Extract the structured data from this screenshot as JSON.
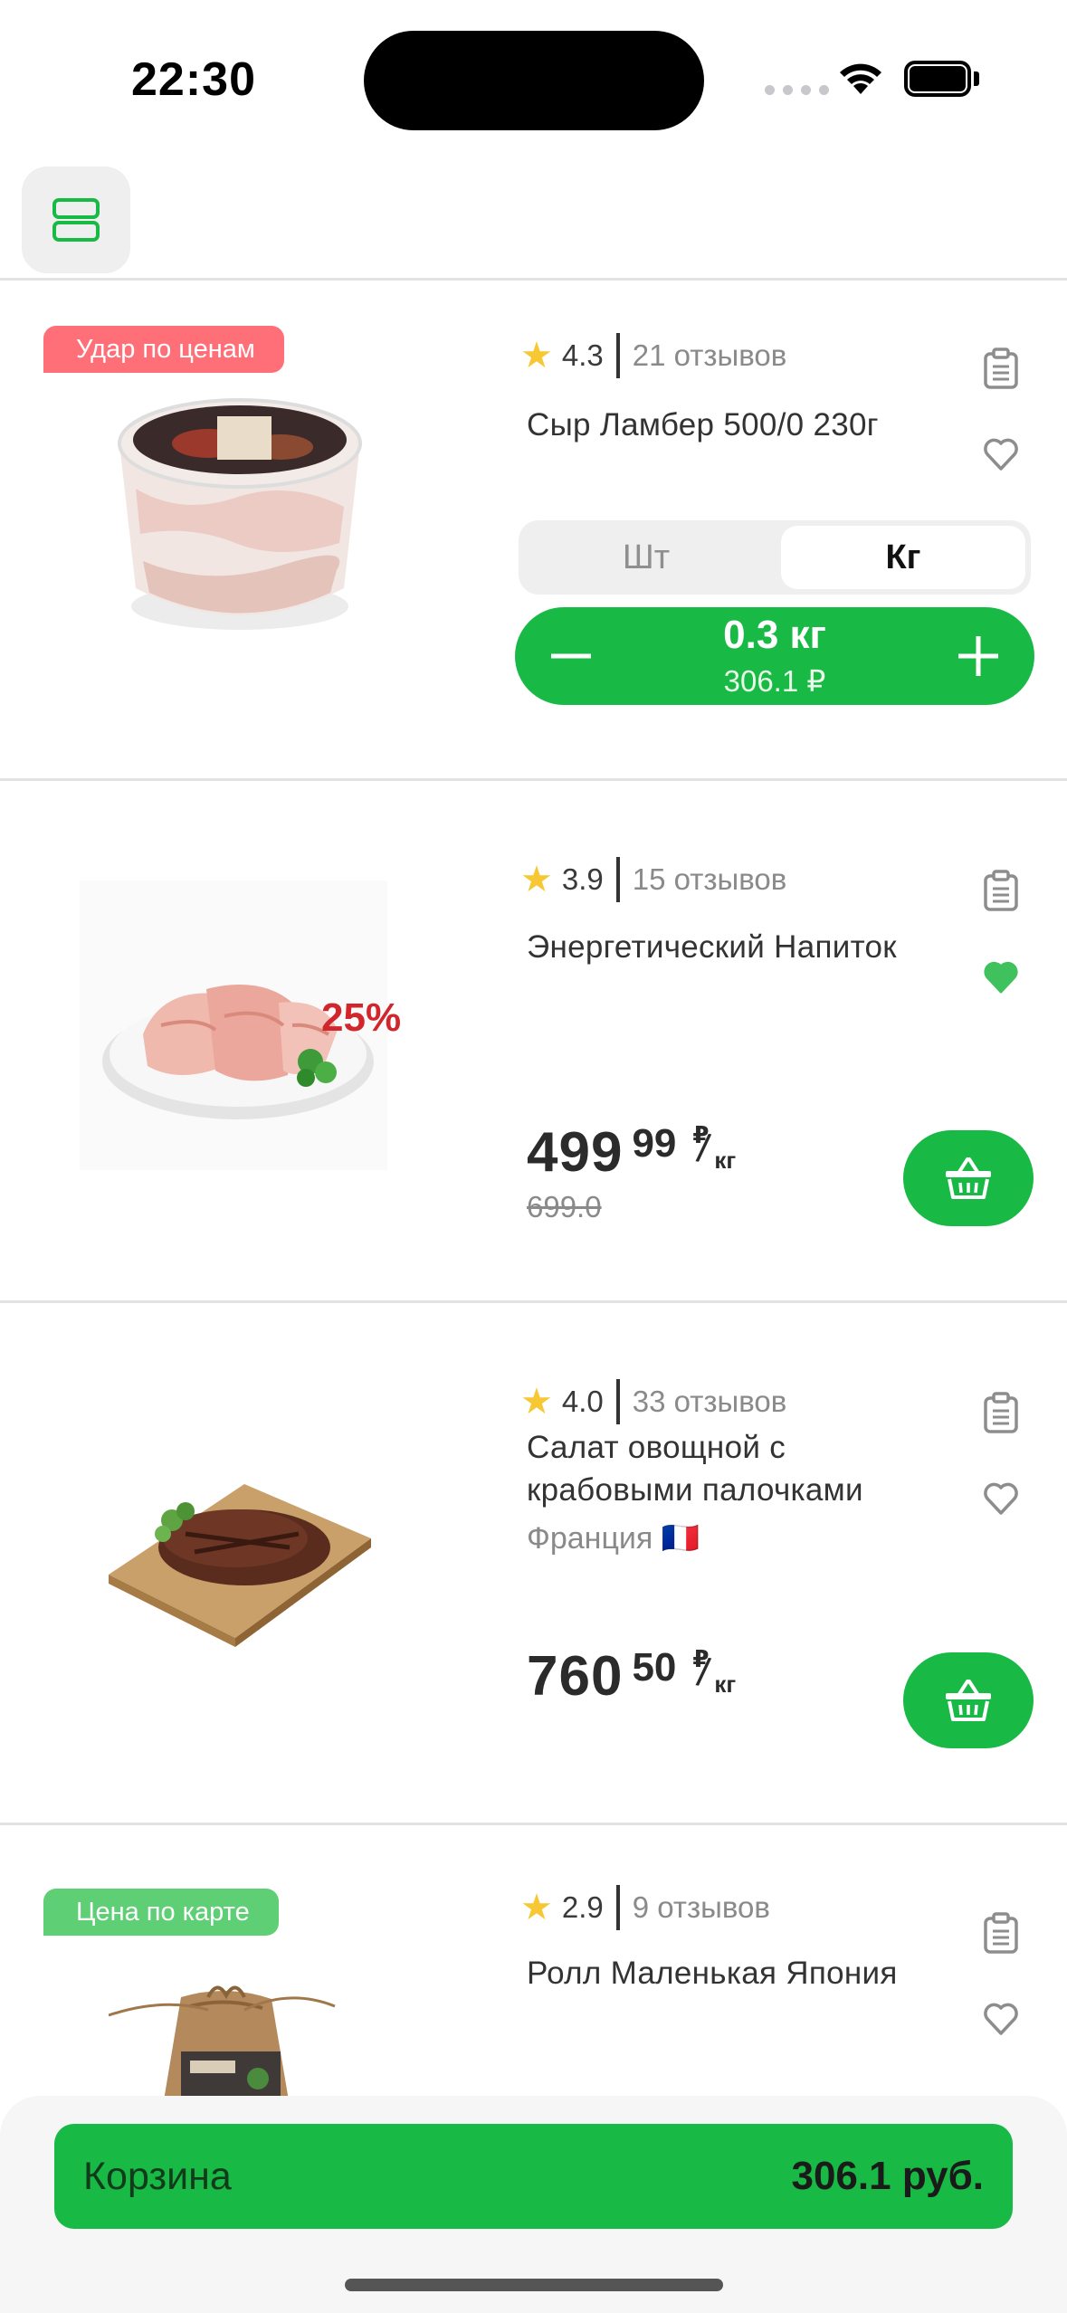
{
  "status_bar": {
    "time": "22:30"
  },
  "toolbar": {
    "layout_icon": "list-layout-icon"
  },
  "colors": {
    "accent": "#18b944",
    "badge_red": "#ff6f78",
    "badge_green": "#5fcf76",
    "discount": "#d2262d",
    "star": "#f7c833"
  },
  "products": [
    {
      "badge": "Удар по ценам",
      "rating": "4.3",
      "reviews": "21 отзывов",
      "title": "Сыр Ламбер 500/0 230г",
      "favorite": false,
      "unit_options": [
        "Шт",
        "Кг"
      ],
      "selected_unit": "Кг",
      "quantity": "0.3 кг",
      "quantity_sum": "306.1 ₽"
    },
    {
      "rating": "3.9",
      "reviews": "15 отзывов",
      "title": "Энергетический Напиток",
      "favorite": true,
      "discount": "25%",
      "price_int": "499",
      "price_frac": "99",
      "price_currency": "₽",
      "price_unit": "кг",
      "old_price": "699.0"
    },
    {
      "rating": "4.0",
      "reviews": "33 отзывов",
      "title": "Салат овощной с крабовыми палочками",
      "origin": "Франция 🇫🇷",
      "favorite": false,
      "price_int": "760",
      "price_frac": "50",
      "price_currency": "₽",
      "price_unit": "кг"
    },
    {
      "badge": "Цена по карте",
      "rating": "2.9",
      "reviews": "9 отзывов",
      "title": "Ролл Маленькая Япония",
      "favorite": false
    }
  ],
  "cart": {
    "label": "Корзина",
    "total": "306.1 руб."
  }
}
